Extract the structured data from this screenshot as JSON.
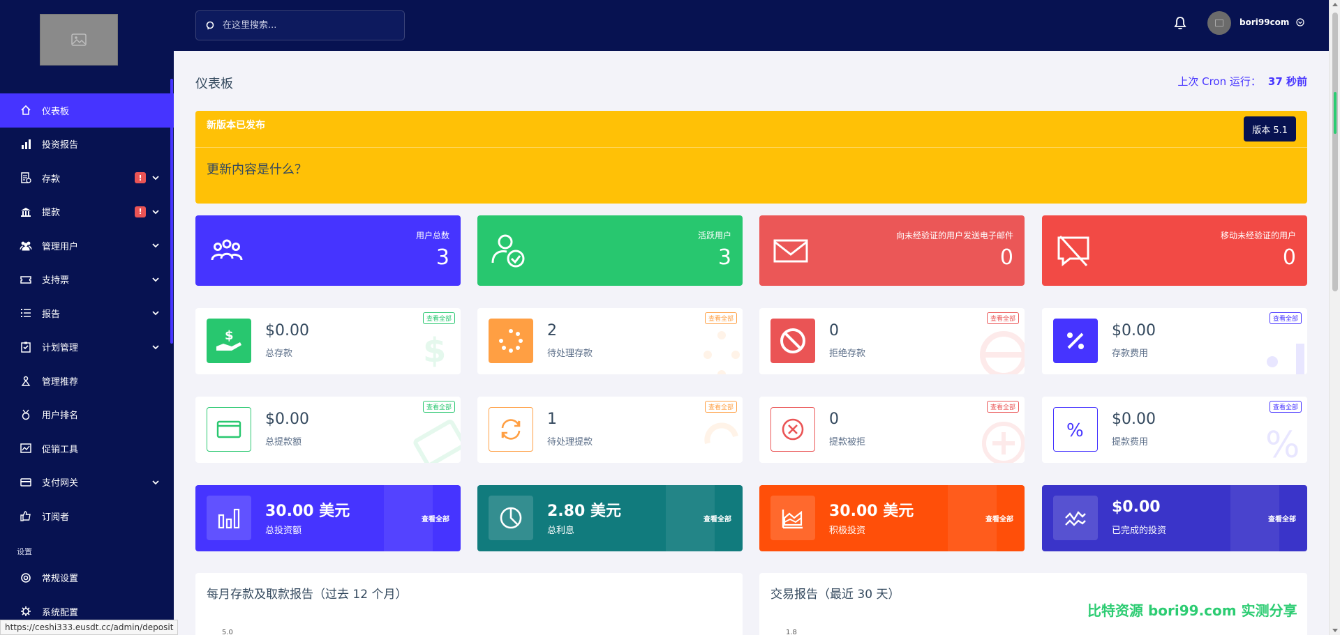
{
  "topbar": {
    "search_placeholder": "在这里搜索...",
    "username": "bori99com"
  },
  "sidebar": {
    "items": [
      {
        "label": "仪表板",
        "icon": "home-icon",
        "active": true
      },
      {
        "label": "投资报告",
        "icon": "bar-chart-icon"
      },
      {
        "label": "存款",
        "icon": "deposit-icon",
        "alert": "!",
        "chevron": true
      },
      {
        "label": "提款",
        "icon": "bank-icon",
        "alert": "!",
        "chevron": true
      },
      {
        "label": "管理用户",
        "icon": "users-icon",
        "chevron": true
      },
      {
        "label": "支持票",
        "icon": "ticket-icon",
        "chevron": true
      },
      {
        "label": "报告",
        "icon": "list-icon",
        "chevron": true
      },
      {
        "label": "计划管理",
        "icon": "checklist-icon",
        "chevron": true
      },
      {
        "label": "管理推荐",
        "icon": "referral-icon"
      },
      {
        "label": "用户排名",
        "icon": "medal-icon"
      },
      {
        "label": "促销工具",
        "icon": "promo-icon"
      },
      {
        "label": "支付网关",
        "icon": "credit-card-icon",
        "chevron": true
      },
      {
        "label": "订阅者",
        "icon": "thumbs-up-icon"
      }
    ],
    "section_label": "设置",
    "settings_items": [
      {
        "label": "常规设置",
        "icon": "settings-circle-icon"
      },
      {
        "label": "系统配置",
        "icon": "gear-icon"
      }
    ]
  },
  "main": {
    "page_title": "仪表板",
    "cron_label": "上次 Cron 运行：",
    "cron_value": "37 秒前"
  },
  "banner": {
    "title": "新版本已发布",
    "version": "版本 5.1",
    "body": "更新内容是什么？"
  },
  "stats_row1": [
    {
      "label": "用户总数",
      "value": "3",
      "color": "#4634ff",
      "icon": "users-group-icon"
    },
    {
      "label": "活跃用户",
      "value": "3",
      "color": "#28c76f",
      "icon": "user-check-icon"
    },
    {
      "label": "向未经验证的用户发送电子邮件",
      "value": "0",
      "color": "#eb5757",
      "icon": "envelope-icon"
    },
    {
      "label": "移动未经验证的用户",
      "value": "0",
      "color": "#f24a45",
      "icon": "comment-slash-icon"
    }
  ],
  "widgets_row2": [
    {
      "value": "$0.00",
      "label": "总存款",
      "link": "查看全部",
      "color": "#28c76f",
      "icon": "hand-dollar-icon"
    },
    {
      "value": "2",
      "label": "待处理存款",
      "link": "查看全部",
      "color": "#ff9f43",
      "icon": "spinner-icon"
    },
    {
      "value": "0",
      "label": "拒绝存款",
      "link": "查看全部",
      "color": "#ea5455",
      "icon": "ban-icon"
    },
    {
      "value": "$0.00",
      "label": "存款费用",
      "link": "查看全部",
      "color": "#4634ff",
      "icon": "percent-icon"
    }
  ],
  "widgets_row3": [
    {
      "value": "$0.00",
      "label": "总提款额",
      "link": "查看全部",
      "color": "#28c76f",
      "icon": "credit-card-outline-icon"
    },
    {
      "value": "1",
      "label": "待处理提款",
      "link": "查看全部",
      "color": "#ff9f43",
      "icon": "sync-icon"
    },
    {
      "value": "0",
      "label": "提款被拒",
      "link": "查看全部",
      "color": "#ea5455",
      "icon": "times-circle-icon"
    },
    {
      "value": "$0.00",
      "label": "提款费用",
      "link": "查看全部",
      "color": "#4634ff",
      "icon": "percent-outline-icon"
    }
  ],
  "gradient_row4": [
    {
      "value": "30.00 美元",
      "label": "总投资额",
      "link": "查看全部",
      "color": "#4634ff",
      "icon": "chart-bar-icon"
    },
    {
      "value": "2.80 美元",
      "label": "总利息",
      "link": "查看全部",
      "color": "#117b7d",
      "icon": "chart-pie-icon"
    },
    {
      "value": "30.00 美元",
      "label": "积极投资",
      "link": "查看全部",
      "color": "#ff4f09",
      "icon": "chart-area-icon"
    },
    {
      "value": "$0.00",
      "label": "已完成的投资",
      "link": "查看全部",
      "color": "#3a34c9",
      "icon": "chart-line-icon"
    }
  ],
  "reports": [
    {
      "title": "每月存款及取款报告（过去 12 个月）",
      "tick": "5.0"
    },
    {
      "title": "交易报告（最近 30 天）",
      "tick": "1.8"
    }
  ],
  "statusbar": {
    "url": "https://ceshi333.eusdt.cc/admin/deposit"
  },
  "watermark": {
    "text": "比特资源 bori99.com 实测分享"
  }
}
